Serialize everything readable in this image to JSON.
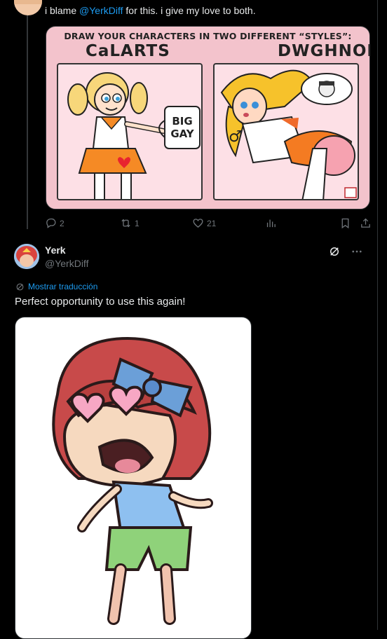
{
  "reply": {
    "text_before": "i blame ",
    "mention": "@YerkDiff",
    "text_after": " for this. i give my love to both."
  },
  "media1": {
    "header": "DRAW YOUR CHARACTERS IN TWO DIFFERENT “STYLES”:",
    "label_left": "CaLARTS",
    "label_right": "DWGHNODS",
    "mug_text": "BIG GAY"
  },
  "actions": {
    "replies": "2",
    "reposts": "1",
    "likes": "21"
  },
  "tweet": {
    "author_name": "Yerk",
    "author_handle": "@YerkDiff",
    "translate_label": "Mostrar traducción",
    "text": "Perfect opportunity to use this again!"
  },
  "icons": {
    "reply": "reply-icon",
    "repost": "repost-icon",
    "like": "heart-icon",
    "views": "views-icon",
    "bookmark": "bookmark-icon",
    "share": "share-icon",
    "grok": "grok-icon",
    "more": "more-icon",
    "translate": "globe-icon"
  },
  "colors": {
    "background": "#000000",
    "text": "#e7e9ea",
    "secondary": "#71767b",
    "accent": "#1d9bf0",
    "divider": "#2f3336"
  }
}
